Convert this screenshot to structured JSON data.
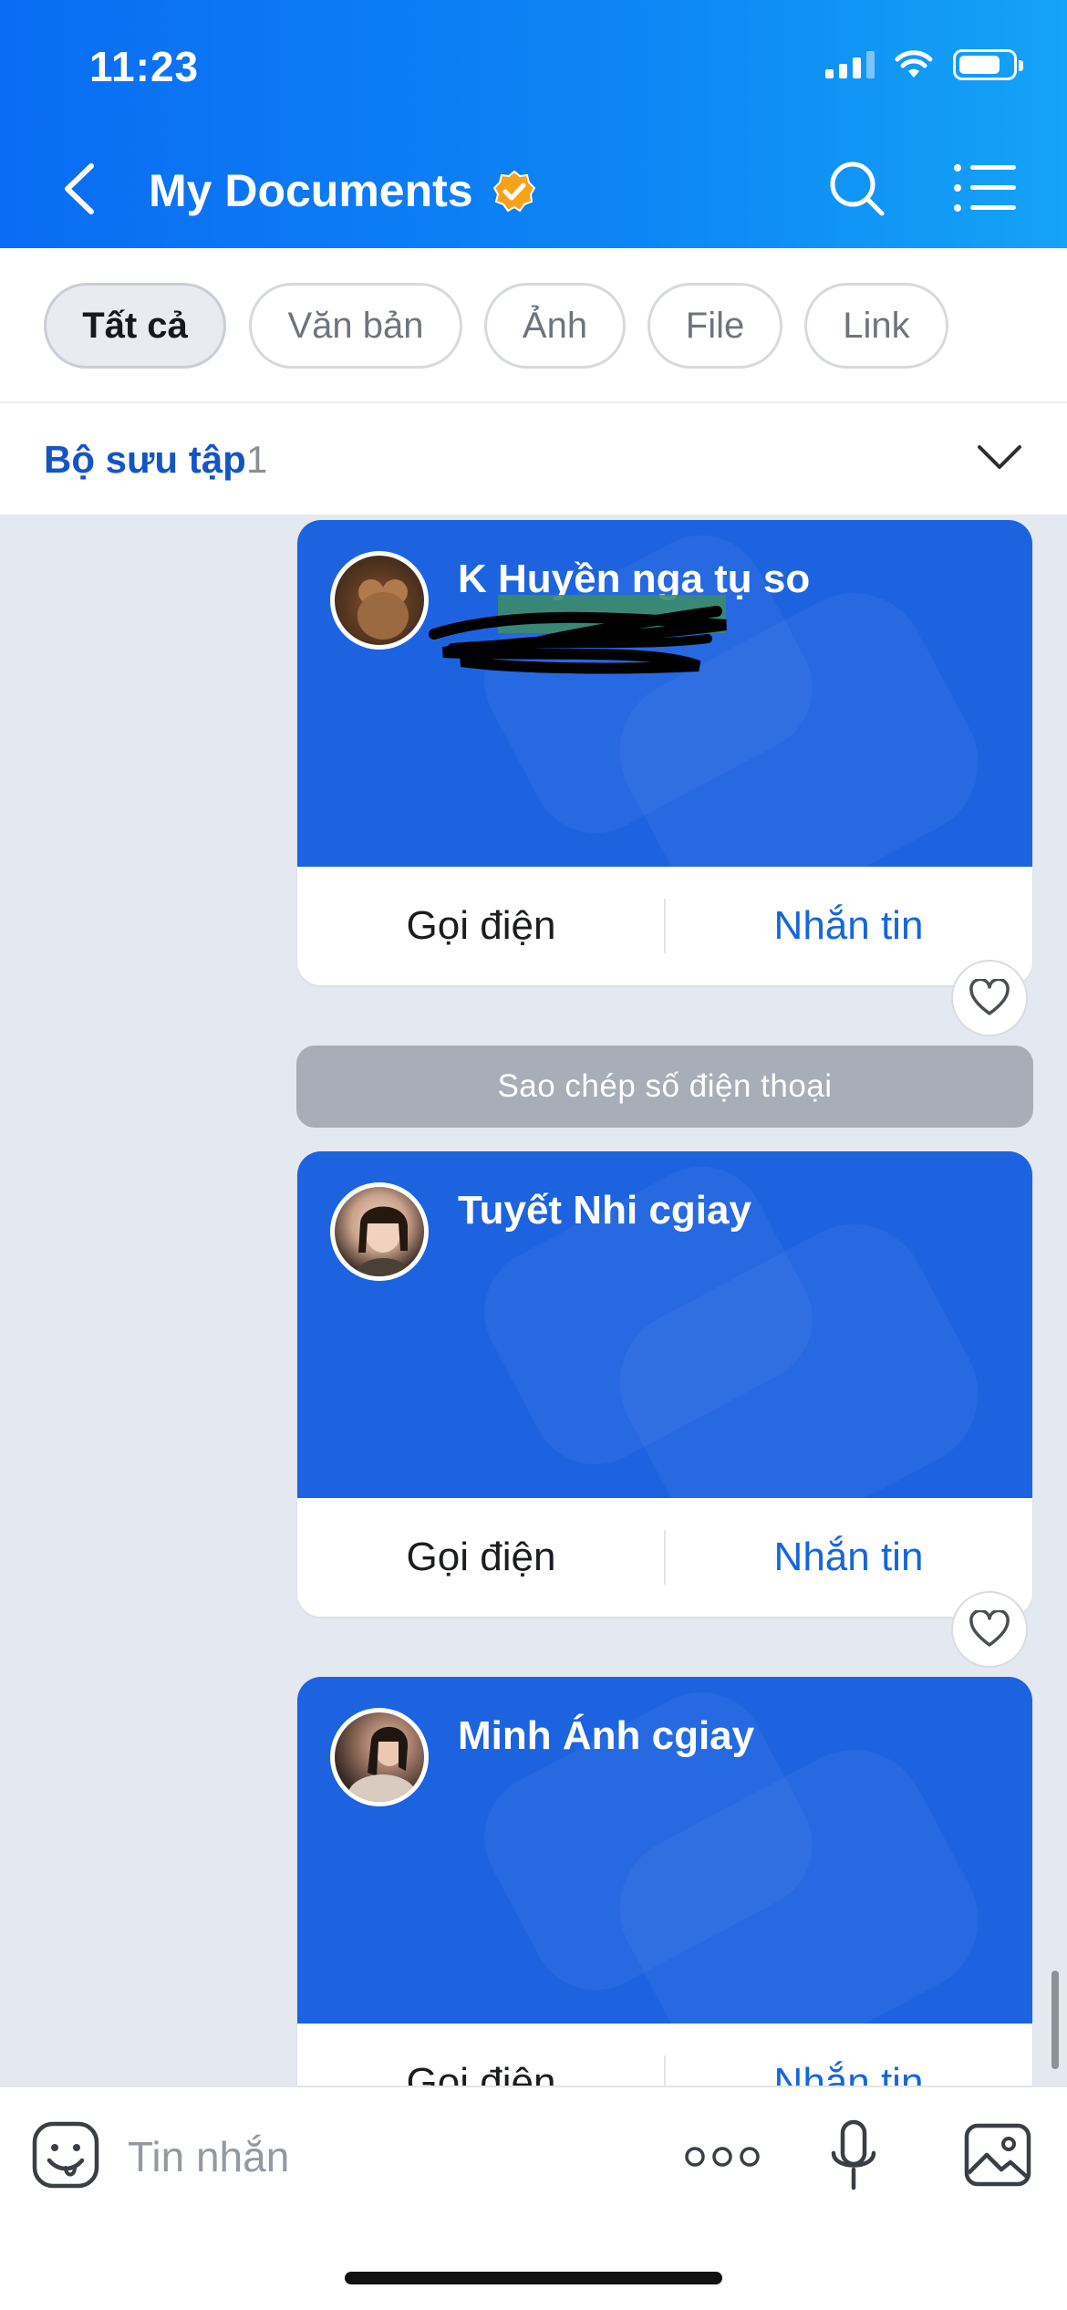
{
  "status_bar": {
    "time": "11:23"
  },
  "header": {
    "title": "My Documents"
  },
  "filters": [
    {
      "label": "Tất cả",
      "active": true
    },
    {
      "label": "Văn bản",
      "active": false
    },
    {
      "label": "Ảnh",
      "active": false
    },
    {
      "label": "File",
      "active": false
    },
    {
      "label": "Link",
      "active": false
    }
  ],
  "collection": {
    "label": "Bộ sưu tập",
    "count": "1"
  },
  "cards": [
    {
      "name": "K Huyền nga tụ so",
      "call_label": "Gọi điện",
      "message_label": "Nhắn tin"
    },
    {
      "name": "Tuyết Nhi cgiay",
      "call_label": "Gọi điện",
      "message_label": "Nhắn tin"
    },
    {
      "name": "Minh Ánh cgiay",
      "call_label": "Gọi điện",
      "message_label": "Nhắn tin"
    }
  ],
  "copy_phone_label": "Sao chép số điện thoại",
  "composer": {
    "placeholder": "Tin nhắn"
  },
  "colors": {
    "header_start": "#0a6cf3",
    "header_end": "#14a3f6",
    "card_blue": "#1d63df",
    "link_blue": "#1666dc",
    "verified_orange": "#f7a21b"
  }
}
